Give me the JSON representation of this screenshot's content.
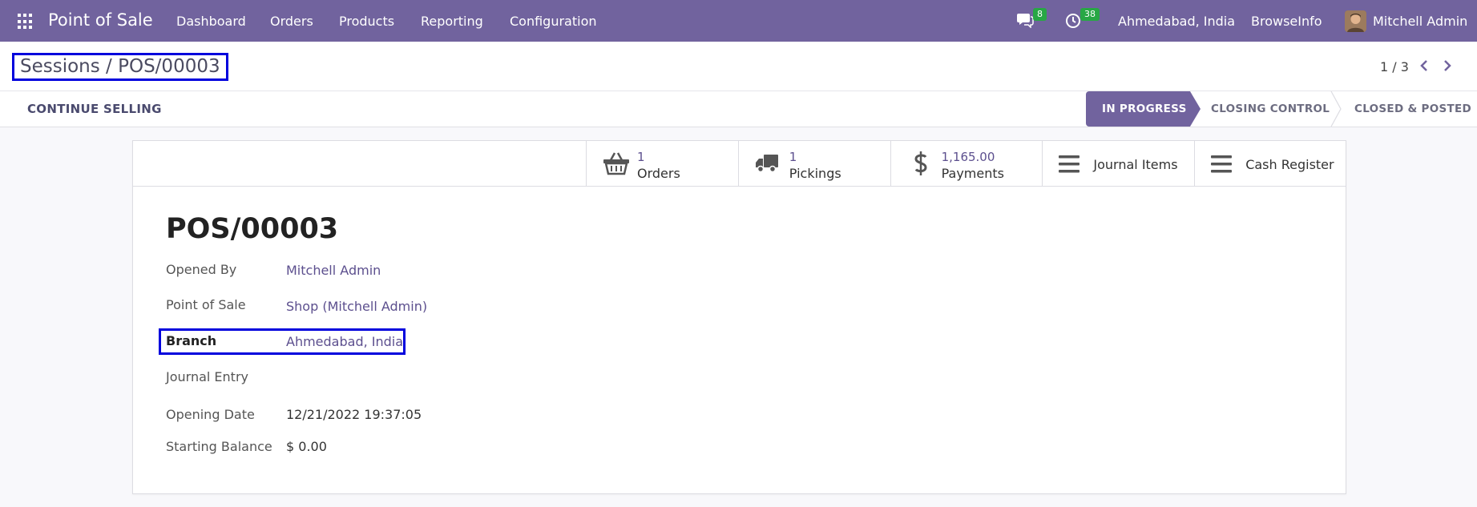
{
  "navbar": {
    "app_title": "Point of Sale",
    "menu": [
      "Dashboard",
      "Orders",
      "Products",
      "Reporting",
      "Configuration"
    ],
    "messages_count": "8",
    "activities_count": "38",
    "branch": "Ahmedabad, India",
    "company": "BrowseInfo",
    "user": "Mitchell Admin"
  },
  "control_panel": {
    "breadcrumb": "Sessions / POS/00003",
    "pager": "1 / 3"
  },
  "statusbar": {
    "continue_label": "CONTINUE SELLING",
    "stages": [
      "IN PROGRESS",
      "CLOSING CONTROL",
      "CLOSED & POSTED"
    ],
    "active_stage": "IN PROGRESS"
  },
  "stat_buttons": {
    "orders": {
      "value": "1",
      "label": "Orders"
    },
    "pickings": {
      "value": "1",
      "label": "Pickings"
    },
    "payments": {
      "value": "1,165.00",
      "label": "Payments"
    },
    "journal_items": {
      "label": "Journal Items"
    },
    "cash_register": {
      "label": "Cash Register"
    }
  },
  "form": {
    "title": "POS/00003",
    "fields": {
      "opened_by": {
        "label": "Opened By",
        "value": "Mitchell Admin"
      },
      "point_of_sale": {
        "label": "Point of Sale",
        "value": "Shop (Mitchell Admin)"
      },
      "branch": {
        "label": "Branch",
        "value": "Ahmedabad, India"
      },
      "journal_entry": {
        "label": "Journal Entry",
        "value": ""
      },
      "opening_date": {
        "label": "Opening Date",
        "value": "12/21/2022 19:37:05"
      },
      "starting_balance": {
        "label": "Starting Balance",
        "value": "$ 0.00"
      }
    }
  },
  "colors": {
    "brand": "#71639e",
    "link": "#5c4f8e",
    "badge": "#28a745",
    "highlight": "#0000dd"
  }
}
